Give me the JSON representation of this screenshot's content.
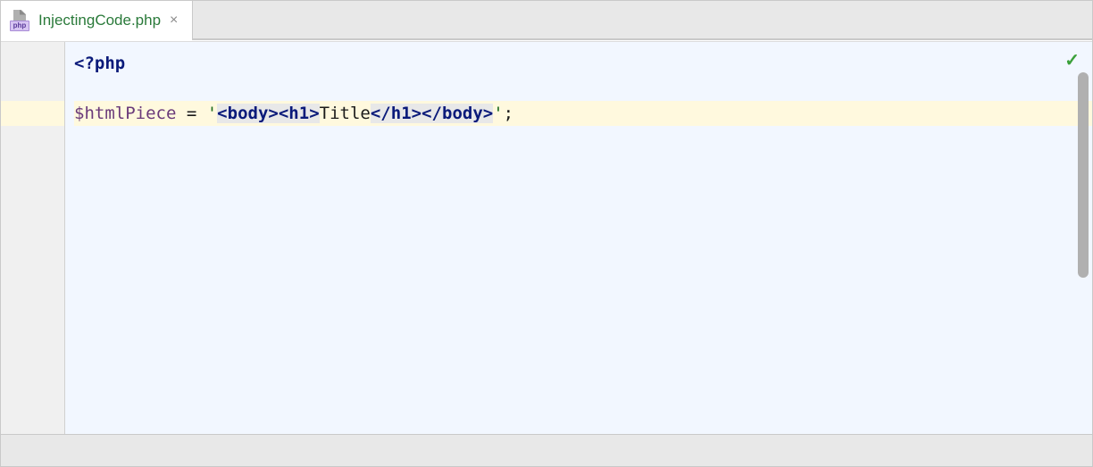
{
  "tab": {
    "label": "InjectingCode.php",
    "icon_badge": "php"
  },
  "editor": {
    "line1": {
      "open_tag": "<?php"
    },
    "line3": {
      "var": "$htmlPiece",
      "eq": " = ",
      "q1": "'",
      "lt1": "<",
      "body_open": "body",
      "gt1": ">",
      "lt2": "<",
      "h1_open": "h1",
      "gt2": ">",
      "text": "Title",
      "lt3": "<",
      "slash1": "/",
      "h1_close": "h1",
      "gt3": ">",
      "lt4": "<",
      "slash2": "/",
      "body_close": "body",
      "gt4": ">",
      "q2": "'",
      "semi": ";"
    }
  },
  "status": {
    "ok_icon": "✓"
  }
}
